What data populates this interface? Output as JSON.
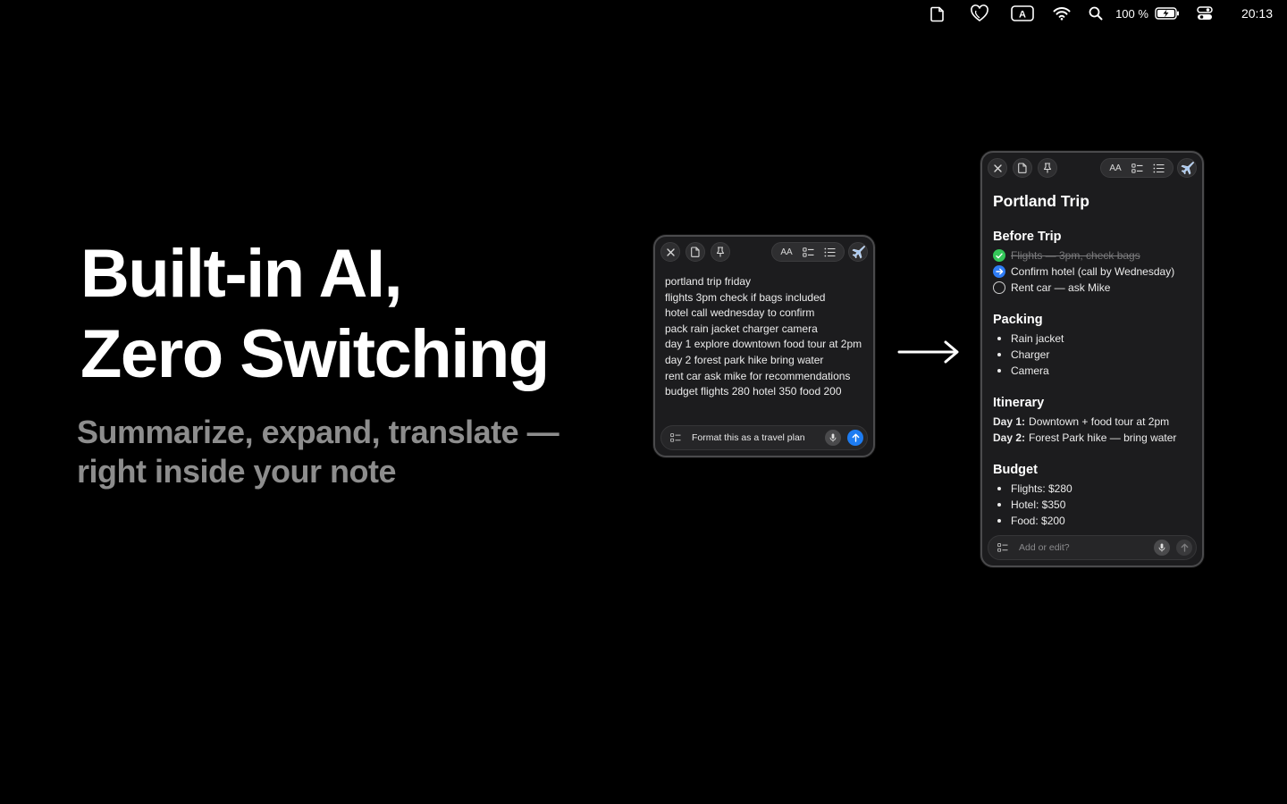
{
  "menubar": {
    "icons": [
      "note-icon",
      "heart-shield-icon",
      "keyboard-a-icon",
      "wifi-icon",
      "search-icon"
    ],
    "input_badge": "A",
    "battery_percent": "100 %",
    "battery_icon": "battery-charging-icon",
    "control_icon": "control-center-icon",
    "clock": "20:13"
  },
  "hero": {
    "title_line1": "Built-in AI,",
    "title_line2": "Zero Switching",
    "subtitle_line1": "Summarize, expand, translate —",
    "subtitle_line2": "right inside your note"
  },
  "toolbar": {
    "close_icon": "close-icon",
    "doc_icon": "document-icon",
    "pin_icon": "pin-icon",
    "text_size_label": "AA",
    "checklist_icon": "checklist-icon",
    "list_icon": "list-icon",
    "ai_icon": "airplane-icon"
  },
  "raw_note": {
    "lines": [
      "portland trip friday",
      "flights 3pm check if bags included",
      "hotel call wednesday to confirm",
      "pack rain jacket charger camera",
      "day 1 explore downtown food tour at 2pm",
      "day 2 forest park hike bring water",
      "rent car ask mike for recommendations",
      "budget flights 280 hotel 350 food 200"
    ],
    "prompt": "Format this as a travel plan"
  },
  "formatted_note": {
    "title": "Portland Trip",
    "before_trip": {
      "heading": "Before Trip",
      "items": [
        {
          "text": "Flights — 3pm, check bags",
          "state": "done"
        },
        {
          "text": "Confirm hotel (call by Wednesday)",
          "state": "active"
        },
        {
          "text": "Rent car — ask Mike",
          "state": "todo"
        }
      ]
    },
    "packing": {
      "heading": "Packing",
      "items": [
        "Rain jacket",
        "Charger",
        "Camera"
      ]
    },
    "itinerary": {
      "heading": "Itinerary",
      "items": [
        {
          "label": "Day 1:",
          "text": "Downtown + food tour at 2pm"
        },
        {
          "label": "Day 2:",
          "text": "Forest Park hike — bring water"
        }
      ]
    },
    "budget": {
      "heading": "Budget",
      "items": [
        "Flights: $280",
        "Hotel: $350",
        "Food: $200"
      ]
    },
    "prompt_placeholder": "Add or edit?"
  }
}
